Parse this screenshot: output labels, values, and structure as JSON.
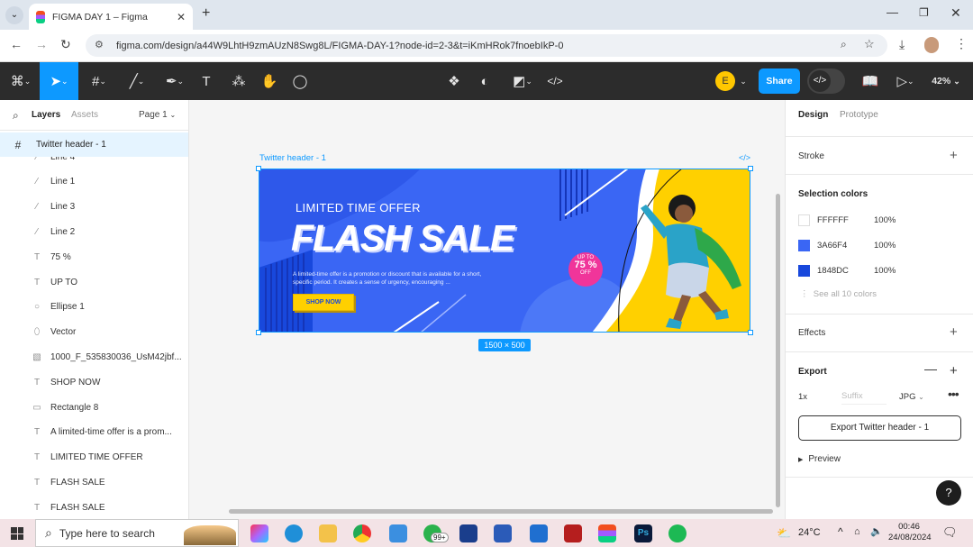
{
  "browser": {
    "tab_title": "FIGMA DAY 1 – Figma",
    "url": "figma.com/design/a44W9LhtH9zmAUzN8Swg8L/FIGMA-DAY-1?node-id=2-3&t=iKmHRok7fnoebIkP-0"
  },
  "toolbar": {
    "share_label": "Share",
    "zoom": "42%",
    "avatar_letter": "E"
  },
  "left_panel": {
    "tab_layers": "Layers",
    "tab_assets": "Assets",
    "page": "Page 1",
    "frame_name": "Twitter header - 1",
    "layers": [
      {
        "icon": "line-icon",
        "name": "Line 4"
      },
      {
        "icon": "line-icon",
        "name": "Line 1"
      },
      {
        "icon": "line-icon",
        "name": "Line 3"
      },
      {
        "icon": "line-icon",
        "name": "Line 2"
      },
      {
        "icon": "text-icon",
        "name": "75 %"
      },
      {
        "icon": "text-icon",
        "name": "UP TO"
      },
      {
        "icon": "ellipse-icon",
        "name": "Ellipse 1"
      },
      {
        "icon": "vector-icon",
        "name": "Vector"
      },
      {
        "icon": "image-icon",
        "name": "1000_F_535830036_UsM42jbf..."
      },
      {
        "icon": "text-icon",
        "name": "SHOP NOW"
      },
      {
        "icon": "rectangle-icon",
        "name": "Rectangle 8"
      },
      {
        "icon": "text-icon",
        "name": "A limited-time offer is a prom..."
      },
      {
        "icon": "text-icon",
        "name": "LIMITED TIME OFFER"
      },
      {
        "icon": "text-icon",
        "name": "FLASH SALE"
      },
      {
        "icon": "text-icon",
        "name": "FLASH SALE"
      }
    ]
  },
  "canvas": {
    "frame_label": "Twitter header - 1",
    "size_badge": "1500 × 500",
    "banner": {
      "kicker": "LIMITED TIME OFFER",
      "headline": "FLASH SALE",
      "body_line1": "A limited-time offer is a promotion or discount that is available for a short,",
      "body_line2": "specific period. It creates a sense of urgency, encouraging ...",
      "cta": "SHOP NOW",
      "badge_top": "UP TO",
      "badge_value": "75 %",
      "badge_bottom": "OFF"
    }
  },
  "right_panel": {
    "tab_design": "Design",
    "tab_prototype": "Prototype",
    "stroke_label": "Stroke",
    "selection_colors_label": "Selection colors",
    "colors": [
      {
        "hex": "FFFFFF",
        "opacity": "100%",
        "swatch": "#ffffff"
      },
      {
        "hex": "3A66F4",
        "opacity": "100%",
        "swatch": "#3a66f4"
      },
      {
        "hex": "1848DC",
        "opacity": "100%",
        "swatch": "#1848dc"
      }
    ],
    "see_all": "See all 10 colors",
    "effects_label": "Effects",
    "export_label": "Export",
    "export_scale": "1x",
    "export_suffix_placeholder": "Suffix",
    "export_format": "JPG",
    "export_button": "Export Twitter header - 1",
    "preview_label": "Preview",
    "help": "?"
  },
  "taskbar": {
    "search_placeholder": "Type here to search",
    "temperature": "24°C",
    "time": "00:46",
    "date": "24/08/2024",
    "notif_badge": "99+"
  },
  "colors": {
    "accent": "#0d99ff",
    "banner_blue": "#3a66f4",
    "banner_dark": "#1848dc",
    "banner_yellow": "#ffd000",
    "badge_pink": "#f0359a"
  }
}
